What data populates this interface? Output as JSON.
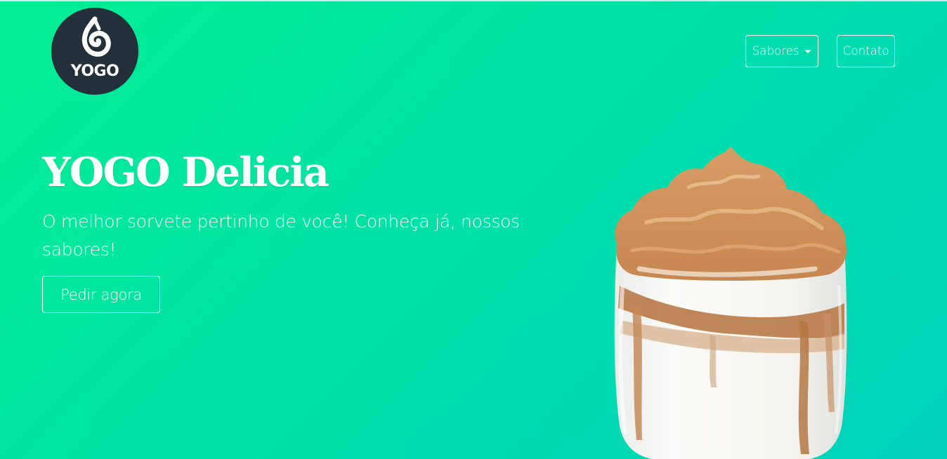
{
  "brand": {
    "logo_text": "YOGO",
    "logo_bg": "#23303a"
  },
  "nav": {
    "items": [
      {
        "label": "Sabores",
        "has_dropdown": true
      },
      {
        "label": "Contato",
        "has_dropdown": false
      }
    ]
  },
  "hero": {
    "title": "YOGO Delicia",
    "subtitle": "O melhor sorvete pertinho de você! Conheça já, nossos sabores!",
    "cta_label": "Pedir agora"
  },
  "colors": {
    "gradient_start": "#03ee93",
    "gradient_end": "#00d2bd",
    "text": "#ffffff",
    "caramel": "#c98a55",
    "cream": "#f3f0ea"
  },
  "icons": {
    "logo_swirl": "swirl-icon",
    "dropdown": "caret-down-icon"
  }
}
